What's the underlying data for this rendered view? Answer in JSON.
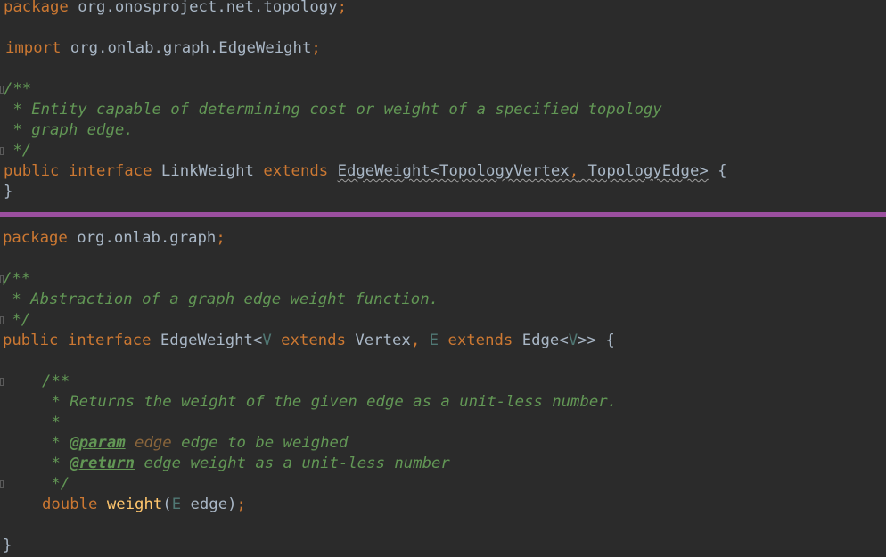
{
  "top_file": {
    "package_kw": "package",
    "package_name": "org.onosproject.net.topology",
    "semicolon": ";",
    "import_kw": "import",
    "import_name": "org.onlab.graph.EdgeWeight",
    "doc_open": "/**",
    "doc_line1": " * Entity capable of determining cost or weight of a specified topology",
    "doc_line2": " * graph edge.",
    "doc_close": " */",
    "public_kw": "public",
    "interface_kw": "interface",
    "class_name": "LinkWeight",
    "extends_kw": "extends",
    "super_type": "EdgeWeight<TopologyVertex",
    "comma": ",",
    "super_type2": " TopologyEdge>",
    "open_brace": " {",
    "close_brace": "}"
  },
  "bottom_file": {
    "package_kw": "package",
    "package_name": "org.onlab.graph",
    "semicolon": ";",
    "doc_open": "/**",
    "doc_line1": " * Abstraction of a graph edge weight function.",
    "doc_close": " */",
    "public_kw": "public",
    "interface_kw": "interface",
    "class_name": "EdgeWeight<",
    "type_v": "V",
    "extends_kw": "extends",
    "vertex": "Vertex",
    "comma": ",",
    "type_e": "E",
    "edge": "Edge<",
    "edge_close": ">>",
    "open_brace": " {",
    "method_doc_open": "/**",
    "method_doc_line1": " * Returns the weight of the given edge as a unit-less number.",
    "method_doc_line2": " *",
    "method_doc_param_star": " * ",
    "param_tag": "@param",
    "param_name": " edge",
    "param_desc": " edge to be weighed",
    "method_doc_return_star": " * ",
    "return_tag": "@return",
    "return_desc": " edge weight as a unit-less number",
    "method_doc_close": " */",
    "return_type": "double",
    "method_name": "weight",
    "paren_open": "(",
    "arg_type": "E",
    "arg_name": " edge",
    "paren_close": ")",
    "close_brace": "}"
  }
}
